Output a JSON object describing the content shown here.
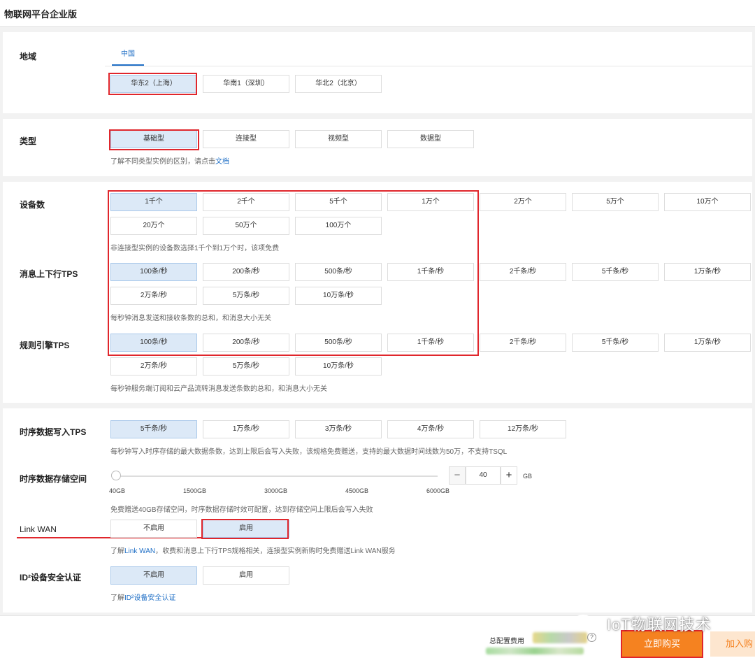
{
  "header": {
    "title": "物联网平台企业版"
  },
  "region": {
    "label": "地域",
    "tab": "中国",
    "options": [
      "华东2（上海）",
      "华南1（深圳）",
      "华北2（北京）"
    ]
  },
  "type": {
    "label": "类型",
    "options": [
      "基础型",
      "连接型",
      "视频型",
      "数据型"
    ],
    "hint_prefix": "了解不同类型实例的区别，请点击",
    "hint_link": "文档"
  },
  "devices": {
    "label": "设备数",
    "options": [
      "1千个",
      "2千个",
      "5千个",
      "1万个",
      "2万个",
      "5万个",
      "10万个",
      "20万个",
      "50万个",
      "100万个"
    ],
    "hint": "非连接型实例的设备数选择1千个到1万个时，该项免费"
  },
  "msg_tps": {
    "label": "消息上下行TPS",
    "options": [
      "100条/秒",
      "200条/秒",
      "500条/秒",
      "1千条/秒",
      "2千条/秒",
      "5千条/秒",
      "1万条/秒",
      "2万条/秒",
      "5万条/秒",
      "10万条/秒"
    ],
    "hint": "每秒钟消息发送和接收条数的总和，和消息大小无关"
  },
  "rule_tps": {
    "label": "规则引擎TPS",
    "options": [
      "100条/秒",
      "200条/秒",
      "500条/秒",
      "1千条/秒",
      "2千条/秒",
      "5千条/秒",
      "1万条/秒",
      "2万条/秒",
      "5万条/秒",
      "10万条/秒"
    ],
    "hint": "每秒钟服务端订阅和云产品流转消息发送条数的总和，和消息大小无关"
  },
  "ts_write": {
    "label": "时序数据写入TPS",
    "options": [
      "5千条/秒",
      "1万条/秒",
      "3万条/秒",
      "4万条/秒",
      "12万条/秒"
    ],
    "hint": "每秒钟写入时序存储的最大数据条数，达到上限后会写入失败，该规格免费赠送，支持的最大数据时间线数为50万，不支持TSQL"
  },
  "ts_storage": {
    "label": "时序数据存储空间",
    "ticks": [
      "40GB",
      "1500GB",
      "3000GB",
      "4500GB",
      "6000GB"
    ],
    "value": "40",
    "unit": "GB",
    "minus": "−",
    "plus": "+",
    "hint": "免费赠送40GB存储空间，时序数据存储时效可配置，达到存储空间上限后会写入失败"
  },
  "link_wan": {
    "label": "Link WAN",
    "options": [
      "不启用",
      "启用"
    ],
    "hint_prefix": "了解",
    "hint_link": "Link WAN",
    "hint_suffix": "，收费和消息上下行TPS规格相关，连接型实例新购时免费赠送Link WAN服务"
  },
  "id2": {
    "label": "ID²设备安全认证",
    "options": [
      "不启用",
      "启用"
    ],
    "hint_prefix": "了解",
    "hint_link": "ID²设备安全认证"
  },
  "footer": {
    "total_label": "总配置费用",
    "help": "?",
    "buy": "立即购买",
    "cart": "加入购"
  },
  "watermark": {
    "text": "IoT物联网技术"
  },
  "colors": {
    "accent": "#1f6fc6",
    "highlight": "#e0262c",
    "buy": "#f58220",
    "selected_bg": "#dce9f7"
  }
}
